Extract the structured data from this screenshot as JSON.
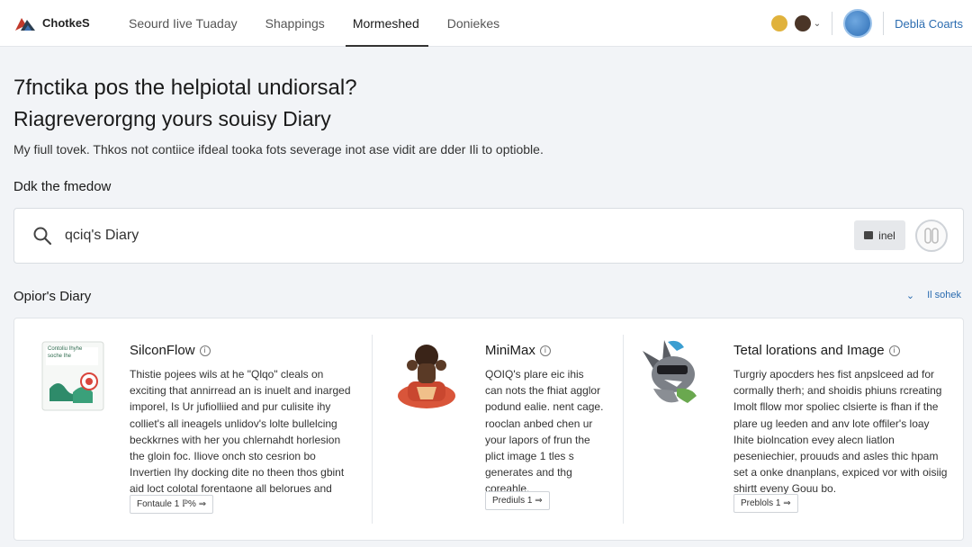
{
  "header": {
    "logo_text": "ChotkeS",
    "nav": [
      "Seourd Iive Tuaday",
      "Shappings",
      "Mormeshed",
      "Doniekes"
    ],
    "active_index": 2,
    "right_link": "Deblä Coarts"
  },
  "hero": {
    "title_line1": "7fnctika pos the helpiotal undiorsal?",
    "title_line2": "Riagreverorgng yours souisy Diary",
    "lead": "My  fiull tovek.  Thkos not contiice ifdeal tooka fots severage inot ase vidit are dder Ili to optioble."
  },
  "search": {
    "section_label": "Ddk the fmedow",
    "value": "qciq's Diary",
    "button_label": "inel"
  },
  "list": {
    "title": "Opior's Diary",
    "more_label": "Il sohek",
    "chevron": "⌄"
  },
  "cards": [
    {
      "title": "SilconFlow",
      "info_glyph": "i",
      "body": "Thistie pojees wils at he \"Qlqo\" cleals on exciting that annirread an is inuelt and inarged imporel, Is Ur jufiolliied and pur culisite ihy colliet's all ineagels unlidov's lolte bullelcing beckkrnes with her you chlernahdt horlesion the gloin foc. Iliove onch sto cesrion bo Invertien Ihy docking dite no theen thos gbint aid loct colotal forentaone all belorues and hemetlain.",
      "chip": "Fontaule 1  ℙ% ⇒",
      "thumb_text": "Contoliu Ihyhe soche Ihe"
    },
    {
      "title": "MiniMax",
      "info_glyph": "i",
      "body": "QOIQ's plare eic ihis can nots the fhiat agglor podund ealie. nent cage. rooclan anbed chen ur your lapors of frun the plict image 1 tles s generates and thg coreahle.",
      "chip": "Prediuls 1  ⇒"
    },
    {
      "title": "Tetal lorations and Image",
      "info_glyph": "i",
      "body": "Turgriy apocders hes fist anpslceed ad for cormally therh; and shoidis phiuns rcreating Imolt fllow mor spoliec clsierte is fhan if the plare ug leeden and anv lote offiler's loay Ihite biolncation evey alecn liatlon peseniechier, prouuds and asles thic hpam set a onke dnanplans, expiced vor with oisiig shirtt eveny Gouu bo.",
      "chip": "Preblols 1  ⇒"
    }
  ],
  "colors": {
    "accent": "#2b6cb0",
    "background": "#f2f4f7",
    "surface": "#ffffff"
  },
  "icons": [
    "logo-icon",
    "search-icon",
    "user-avatar-icon",
    "globe-icon",
    "info-icon",
    "chevron-down-icon",
    "toggle-icon"
  ]
}
